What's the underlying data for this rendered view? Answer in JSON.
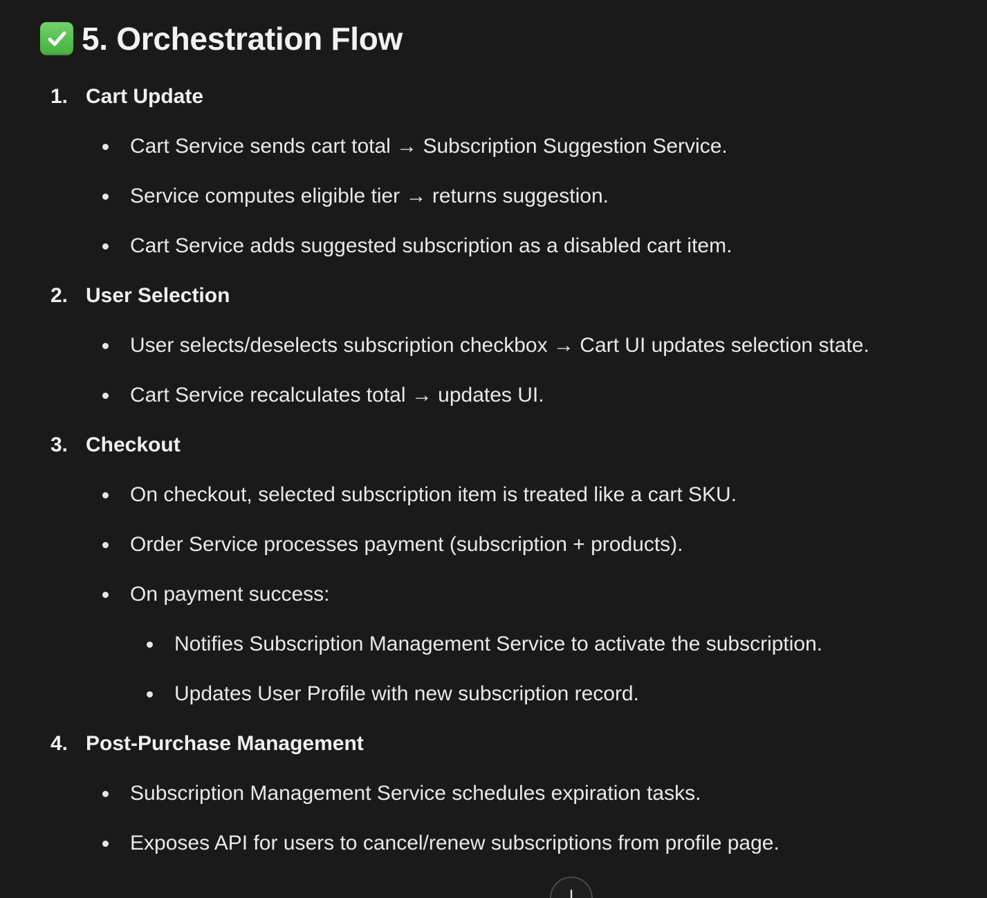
{
  "heading": {
    "icon": "check-mark-button-icon",
    "text": "5. Orchestration Flow"
  },
  "sections": [
    {
      "number": "1.",
      "title": "Cart Update",
      "items": [
        "Cart Service sends cart total → Subscription Suggestion Service.",
        "Service computes eligible tier → returns suggestion.",
        "Cart Service adds suggested subscription as a disabled cart item."
      ]
    },
    {
      "number": "2.",
      "title": "User Selection",
      "items": [
        "User selects/deselects subscription checkbox → Cart UI updates selection state.",
        "Cart Service recalculates total → updates UI."
      ]
    },
    {
      "number": "3.",
      "title": "Checkout",
      "items": [
        "On checkout, selected subscription item is treated like a cart SKU.",
        "Order Service processes payment (subscription + products).",
        "On payment success:"
      ],
      "subitems": [
        "Notifies Subscription Management Service to activate the subscription.",
        "Updates User Profile with new subscription record."
      ]
    },
    {
      "number": "4.",
      "title": "Post-Purchase Management",
      "items": [
        "Subscription Management Service schedules expiration tasks.",
        "Exposes API for users to cancel/renew subscriptions from profile page."
      ]
    }
  ],
  "scroll_button": {
    "icon": "arrow-down-icon"
  }
}
